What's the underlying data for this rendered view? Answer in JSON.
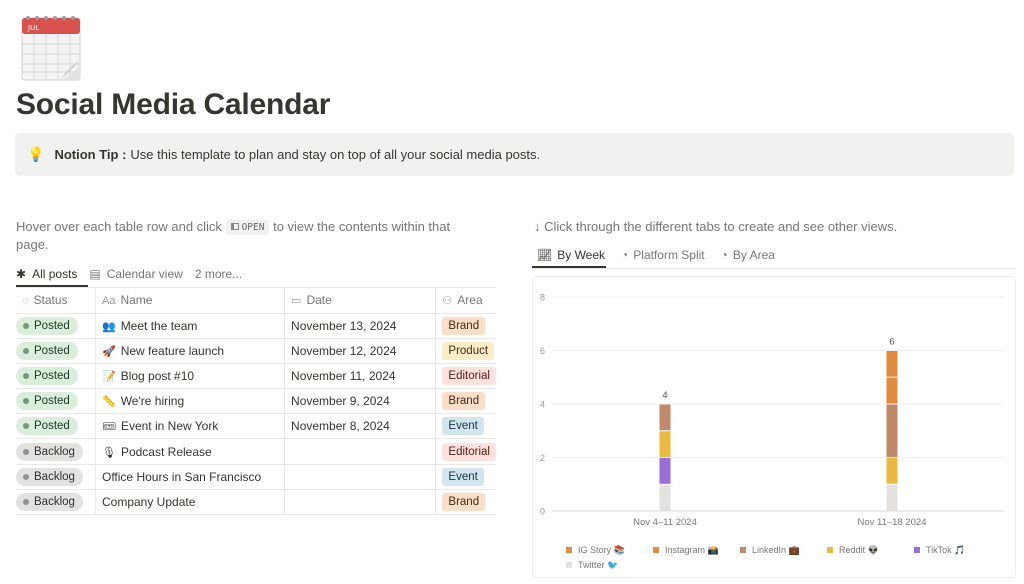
{
  "page": {
    "title": "Social Media Calendar",
    "icon": "calendar-icon",
    "icon_month": "JUL"
  },
  "callout": {
    "icon": "lightbulb-icon",
    "bold": "Notion Tip :",
    "text": "Use this template to plan and stay on top of all your social media posts."
  },
  "left": {
    "hint_before": "Hover over each table row and click",
    "hint_kbd": "OPEN",
    "hint_after": "to view the contents within that page.",
    "tabs": [
      {
        "label": "All posts",
        "icon": "asterisk-icon"
      },
      {
        "label": "Calendar view",
        "icon": "calendar-icon"
      },
      {
        "label": "2 more...",
        "icon": ""
      }
    ],
    "columns": [
      {
        "label": "Status",
        "icon": "status-icon"
      },
      {
        "label": "Name",
        "icon": "text-icon",
        "prefix": "Aa"
      },
      {
        "label": "Date",
        "icon": "calendar-icon"
      },
      {
        "label": "Area",
        "icon": "people-icon"
      }
    ],
    "rows": [
      {
        "status": "Posted",
        "emoji": "👥",
        "name": "Meet the team",
        "date": "November 13, 2024",
        "area": "Brand"
      },
      {
        "status": "Posted",
        "emoji": "🚀",
        "name": "New feature launch",
        "date": "November 12, 2024",
        "area": "Product"
      },
      {
        "status": "Posted",
        "emoji": "📝",
        "name": "Blog post #10",
        "date": "November 11, 2024",
        "area": "Editorial"
      },
      {
        "status": "Posted",
        "emoji": "📏",
        "name": "We're hiring",
        "date": "November 9, 2024",
        "area": "Brand"
      },
      {
        "status": "Posted",
        "emoji": "🎟",
        "name": "Event in New York",
        "date": "November 8, 2024",
        "area": "Event"
      },
      {
        "status": "Backlog",
        "emoji": "🎙",
        "name": "Podcast Release",
        "date": "",
        "area": "Editorial"
      },
      {
        "status": "Backlog",
        "emoji": "",
        "name": "Office Hours in San Francisco",
        "date": "",
        "area": "Event"
      },
      {
        "status": "Backlog",
        "emoji": "",
        "name": "Company Update",
        "date": "",
        "area": "Brand"
      }
    ],
    "area_colors": {
      "Brand": {
        "bg": "#fadec9",
        "fg": "#49290e"
      },
      "Product": {
        "bg": "#fdecc8",
        "fg": "#402c1b"
      },
      "Editorial": {
        "bg": "#ffe2dd",
        "fg": "#5d1715"
      },
      "Event": {
        "bg": "#d3e5ef",
        "fg": "#183347"
      }
    }
  },
  "right": {
    "hint": "↓ Click through the different tabs to create and see other views.",
    "tabs": [
      {
        "label": "By Week",
        "icon": "chart-icon"
      },
      {
        "label": "Platform Split",
        "icon": "pie-icon"
      },
      {
        "label": "By Area",
        "icon": "pie-icon"
      }
    ]
  },
  "chart_data": {
    "type": "bar",
    "stacked": true,
    "categories": [
      "Nov 4–11 2024",
      "Nov 11–18 2024"
    ],
    "totals": [
      4,
      6
    ],
    "ylim": [
      0,
      8
    ],
    "yticks": [
      0,
      2,
      4,
      6,
      8
    ],
    "grid": true,
    "legend_position": "bottom-left",
    "series": [
      {
        "name": "Twitter 🐦",
        "color": "#e3e2e0",
        "values": [
          1,
          1
        ]
      },
      {
        "name": "TikTok 🎵",
        "color": "#9a6dd7",
        "values": [
          1,
          0
        ]
      },
      {
        "name": "Reddit 👽",
        "color": "#e9b940",
        "values": [
          1,
          1
        ]
      },
      {
        "name": "LinkedIn 💼",
        "color": "#c0896a",
        "values": [
          1,
          2
        ]
      },
      {
        "name": "Instagram 📸",
        "color": "#e38b3c",
        "values": [
          0,
          1
        ]
      },
      {
        "name": "IG Story 📚",
        "color": "#e38b3c",
        "values": [
          0,
          1
        ]
      }
    ],
    "legend_order": [
      "IG Story 📚",
      "Instagram 📸",
      "LinkedIn 💼",
      "Reddit 👽",
      "TikTok 🎵",
      "Twitter 🐦"
    ]
  }
}
